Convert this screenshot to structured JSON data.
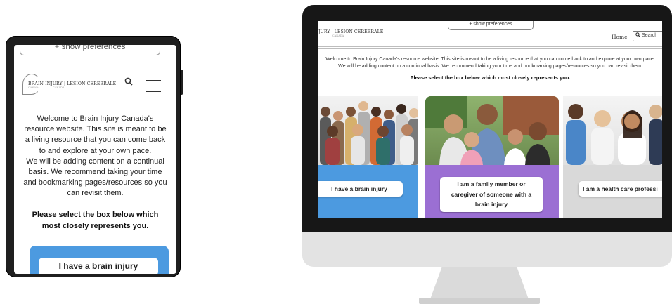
{
  "tablet": {
    "preferences_label": "+ show preferences",
    "logo": {
      "en": "BRAIN INJURY",
      "fr": "LÉSION CÉRÉBRALE",
      "sub_en": "CANADA",
      "sub_fr": "CANADA"
    },
    "welcome_lines": [
      "Welcome to Brain Injury Canada's",
      "resource website. This site is meant to be",
      "a living resource that you can come back",
      "to and explore at your own pace.",
      "We will be adding content on a continual",
      "basis. We recommend taking your time",
      "and bookmarking pages/resources so you",
      "can revisit them."
    ],
    "select_lines": [
      "Please select the box below which",
      "most closely represents you."
    ],
    "card_label": "I have a brain injury",
    "card_color": "#4c9ae0"
  },
  "desktop": {
    "preferences_label": "+ show preferences",
    "logo": {
      "en": "JURY",
      "fr": "LÉSION CÉRÉBRALE",
      "sub": "CANADA"
    },
    "nav_home": "Home",
    "search_label": "Search",
    "welcome_lines": [
      "Welcome to Brain Injury Canada's resource website. This site is meant to be a living resource that you can come back to and explore at your own pace.",
      "We will be adding content on a continual basis. We recommend taking your time and bookmarking pages/resources so you can revisit them."
    ],
    "select_text": "Please select the box below which most closely represents you.",
    "cards": [
      {
        "label": "I have a brain injury",
        "color": "#4c9ae0"
      },
      {
        "label_lines": [
          "I am a family member or",
          "caregiver of someone with a",
          "brain injury"
        ],
        "color": "#9b6fd3"
      },
      {
        "label": "I am a health care professi",
        "color": "#d9d9d9"
      }
    ]
  },
  "icons": [
    "search-icon",
    "hamburger-menu-icon",
    "brain-logo-icon"
  ]
}
